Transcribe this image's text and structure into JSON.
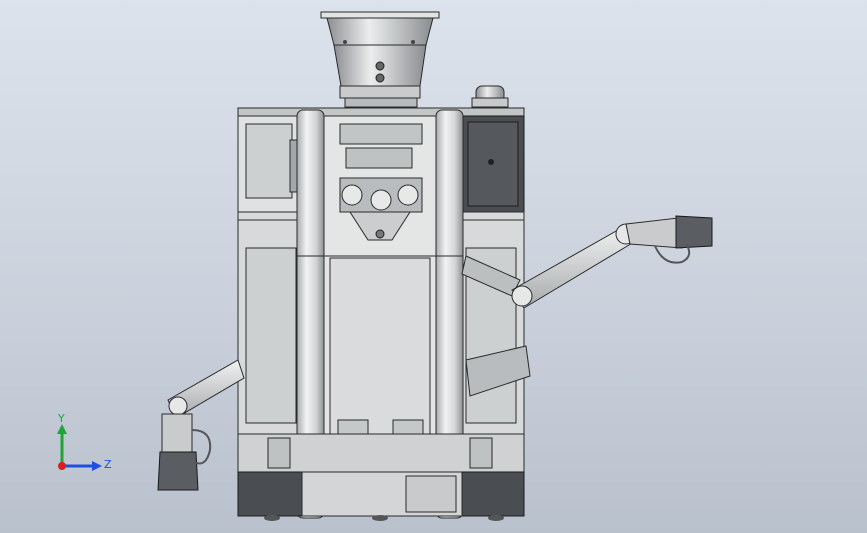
{
  "viewport": {
    "background_colors": [
      "#dde3ec",
      "#b9c1cd"
    ],
    "model_color": "#d2d4d4",
    "edge_color": "#2a2a2a",
    "dark_panel_color": "#4a4d52"
  },
  "triad": {
    "x_axis_color": "#1f4fe0",
    "y_axis_color": "#22a33a",
    "z_axis_color": "#d42020",
    "y_label": "Y",
    "z_label": "Z"
  }
}
